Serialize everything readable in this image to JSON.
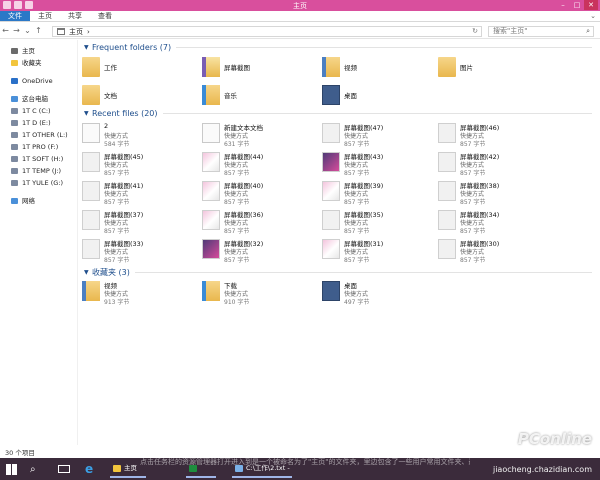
{
  "window": {
    "title": "主页"
  },
  "ribbon": {
    "tabs": [
      "文件",
      "主页",
      "共享",
      "查看"
    ]
  },
  "address": {
    "path": "主页",
    "search_placeholder": "搜索\"主页\""
  },
  "sidebar": {
    "items": [
      {
        "label": "主页",
        "icon": "home-icon",
        "color": "#6b6b6b"
      },
      {
        "label": "收藏夹",
        "icon": "star-icon",
        "color": "#f2c53d"
      },
      {
        "label": "OneDrive",
        "icon": "cloud-icon",
        "color": "#2a70c8"
      },
      {
        "label": "这台电脑",
        "icon": "pc-icon",
        "color": "#4a90d9"
      },
      {
        "label": "1T C (C:)",
        "icon": "drive-icon",
        "color": "#7d8aa0"
      },
      {
        "label": "1T D (E:)",
        "icon": "drive-icon",
        "color": "#7d8aa0"
      },
      {
        "label": "1T OTHER (L:)",
        "icon": "drive-icon",
        "color": "#7d8aa0"
      },
      {
        "label": "1T PRO (F:)",
        "icon": "drive-icon",
        "color": "#7d8aa0"
      },
      {
        "label": "1T SOFT (H:)",
        "icon": "drive-icon",
        "color": "#7d8aa0"
      },
      {
        "label": "1T TEMP (J:)",
        "icon": "drive-icon",
        "color": "#7d8aa0"
      },
      {
        "label": "1T YULE (G:)",
        "icon": "drive-icon",
        "color": "#7d8aa0"
      },
      {
        "label": "网络",
        "icon": "network-icon",
        "color": "#4a90d9"
      }
    ]
  },
  "sections": {
    "frequent": "Frequent folders (7)",
    "recent": "Recent files (20)",
    "favorites": "收藏夹 (3)"
  },
  "frequent_folders": [
    {
      "name": "工作",
      "icon": "folder"
    },
    {
      "name": "屏幕截图",
      "icon": "folder-open"
    },
    {
      "name": "视频",
      "icon": "video-folder"
    },
    {
      "name": "图片",
      "icon": "folder"
    },
    {
      "name": "文档",
      "icon": "folder"
    },
    {
      "name": "音乐",
      "icon": "music-folder"
    },
    {
      "name": "桌面",
      "icon": "file-shot desk"
    }
  ],
  "recent_files": [
    {
      "name": "2",
      "type": "快捷方式",
      "size": "584 字节",
      "icon": "file-doc"
    },
    {
      "name": "新建文本文档",
      "type": "快捷方式",
      "size": "631 字节",
      "icon": "file-doc"
    },
    {
      "name": "屏幕截图(47)",
      "type": "快捷方式",
      "size": "857 字节",
      "icon": "file-shot"
    },
    {
      "name": "屏幕截图(46)",
      "type": "快捷方式",
      "size": "857 字节",
      "icon": "file-shot"
    },
    {
      "name": "屏幕截图(45)",
      "type": "快捷方式",
      "size": "857 字节",
      "icon": "file-shot"
    },
    {
      "name": "屏幕截图(44)",
      "type": "快捷方式",
      "size": "857 字节",
      "icon": "file-shot pink"
    },
    {
      "name": "屏幕截图(43)",
      "type": "快捷方式",
      "size": "857 字节",
      "icon": "file-shot dark"
    },
    {
      "name": "屏幕截图(42)",
      "type": "快捷方式",
      "size": "857 字节",
      "icon": "file-shot"
    },
    {
      "name": "屏幕截图(41)",
      "type": "快捷方式",
      "size": "857 字节",
      "icon": "file-shot"
    },
    {
      "name": "屏幕截图(40)",
      "type": "快捷方式",
      "size": "857 字节",
      "icon": "file-shot pink"
    },
    {
      "name": "屏幕截图(39)",
      "type": "快捷方式",
      "size": "857 字节",
      "icon": "file-shot pink"
    },
    {
      "name": "屏幕截图(38)",
      "type": "快捷方式",
      "size": "857 字节",
      "icon": "file-shot"
    },
    {
      "name": "屏幕截图(37)",
      "type": "快捷方式",
      "size": "857 字节",
      "icon": "file-shot"
    },
    {
      "name": "屏幕截图(36)",
      "type": "快捷方式",
      "size": "857 字节",
      "icon": "file-shot pink"
    },
    {
      "name": "屏幕截图(35)",
      "type": "快捷方式",
      "size": "857 字节",
      "icon": "file-shot"
    },
    {
      "name": "屏幕截图(34)",
      "type": "快捷方式",
      "size": "857 字节",
      "icon": "file-shot"
    },
    {
      "name": "屏幕截图(33)",
      "type": "快捷方式",
      "size": "857 字节",
      "icon": "file-shot"
    },
    {
      "name": "屏幕截图(32)",
      "type": "快捷方式",
      "size": "857 字节",
      "icon": "file-shot dark"
    },
    {
      "name": "屏幕截图(31)",
      "type": "快捷方式",
      "size": "857 字节",
      "icon": "file-shot pink"
    },
    {
      "name": "屏幕截图(30)",
      "type": "快捷方式",
      "size": "857 字节",
      "icon": "file-shot"
    }
  ],
  "favorites": [
    {
      "name": "视频",
      "type": "快捷方式",
      "size": "913 字节",
      "icon": "video-folder"
    },
    {
      "name": "下载",
      "type": "快捷方式",
      "size": "910 字节",
      "icon": "down-folder"
    },
    {
      "name": "桌面",
      "type": "快捷方式",
      "size": "497 字节",
      "icon": "file-shot desk"
    }
  ],
  "status": {
    "count": "30 个项目"
  },
  "taskbar": {
    "apps": [
      {
        "label": "主页",
        "color": "#f2c53d"
      },
      {
        "label": "",
        "color": "#1e8e3e"
      },
      {
        "label": "C:\\工作\\2.txt - ...",
        "color": "#7ab0e8"
      }
    ],
    "watermark_text": "点击任务栏的资源管理器打开进入到是一个被命名为了\"主页\"的文件夹，里边包含了一些用户常用文件夹、最近 常用文件以及收藏夹",
    "brand": "PConline",
    "site": "jiaocheng.chazidian.com"
  }
}
